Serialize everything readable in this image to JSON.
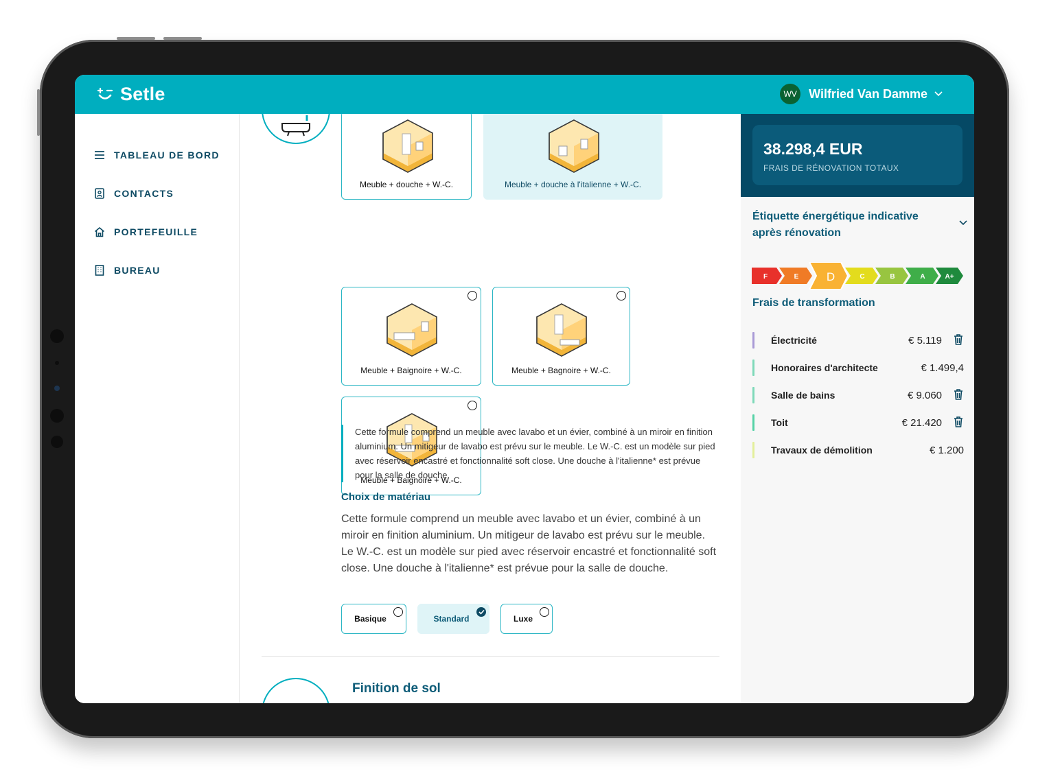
{
  "header": {
    "logo_text": "Setle",
    "user_initials": "WV",
    "user_name": "Wilfried Van Damme"
  },
  "sidebar": {
    "items": [
      {
        "label": "TABLEAU DE BORD",
        "icon": "menu-icon"
      },
      {
        "label": "CONTACTS",
        "icon": "contacts-icon"
      },
      {
        "label": "PORTEFEUILLE",
        "icon": "home-icon"
      },
      {
        "label": "BUREAU",
        "icon": "building-icon"
      }
    ]
  },
  "main": {
    "options": [
      {
        "label": "Meuble + douche + W.-C.",
        "selected": false
      },
      {
        "label": "Meuble + douche à l'italienne + W.-C.",
        "selected": true
      },
      {
        "label": "Meuble + Baignoire + W.-C.",
        "selected": false
      },
      {
        "label": "Meuble + Bagnoire + W.-C.",
        "selected": false
      },
      {
        "label": "Meuble + Baignoire + W.-C.",
        "selected": false
      }
    ],
    "quote": "Cette formule comprend un meuble avec lavabo et un évier, combiné à un miroir en finition aluminium. Un mitigeur de lavabo est prévu sur le meuble. Le W.-C. est un modèle sur pied avec réservoir encastré et fonctionnalité soft close. Une douche à l'italienne* est prévue pour la salle de douche.",
    "material_title": "Choix de matériau",
    "material_text": "Cette formule comprend un meuble avec lavabo et un évier, combiné à un miroir en finition aluminium. Un mitigeur de lavabo est prévu sur le meuble. Le W.-C. est un modèle sur pied avec réservoir encastré et fonctionnalité soft close. Une douche à l'italienne* est prévue pour la salle de douche.",
    "levels": [
      {
        "label": "Basique",
        "selected": false
      },
      {
        "label": "Standard",
        "selected": true
      },
      {
        "label": "Luxe",
        "selected": false
      }
    ],
    "next_section_title": "Finition de sol"
  },
  "panel": {
    "total_amount": "38.298,4 EUR",
    "total_label": "FRAIS DE RÉNOVATION TOTAUX",
    "energy_title": "Étiquette énergétique indicative après rénovation",
    "energy_labels": [
      {
        "label": "F",
        "color": "#e8312b"
      },
      {
        "label": "E",
        "color": "#f07b26"
      },
      {
        "label": "D",
        "color": "#f9b233"
      },
      {
        "label": "C",
        "color": "#e3dc1d"
      },
      {
        "label": "B",
        "color": "#98c540"
      },
      {
        "label": "A",
        "color": "#3fae49"
      },
      {
        "label": "A+",
        "color": "#1f8a3d"
      }
    ],
    "energy_selected": "D",
    "costs_title": "Frais de transformation",
    "costs": [
      {
        "label": "Électricité",
        "value": "€ 5.119",
        "color": "#a99ad6",
        "deletable": true
      },
      {
        "label": "Honoraires d'architecte",
        "value": "€ 1.499,4",
        "color": "#7ed9b9",
        "deletable": false
      },
      {
        "label": "Salle de bains",
        "value": "€ 9.060",
        "color": "#7ed9b9",
        "deletable": true
      },
      {
        "label": "Toit",
        "value": "€ 21.420",
        "color": "#55d2a6",
        "deletable": true
      },
      {
        "label": "Travaux de démolition",
        "value": "€ 1.200",
        "color": "#e3ef9a",
        "deletable": false
      }
    ]
  }
}
